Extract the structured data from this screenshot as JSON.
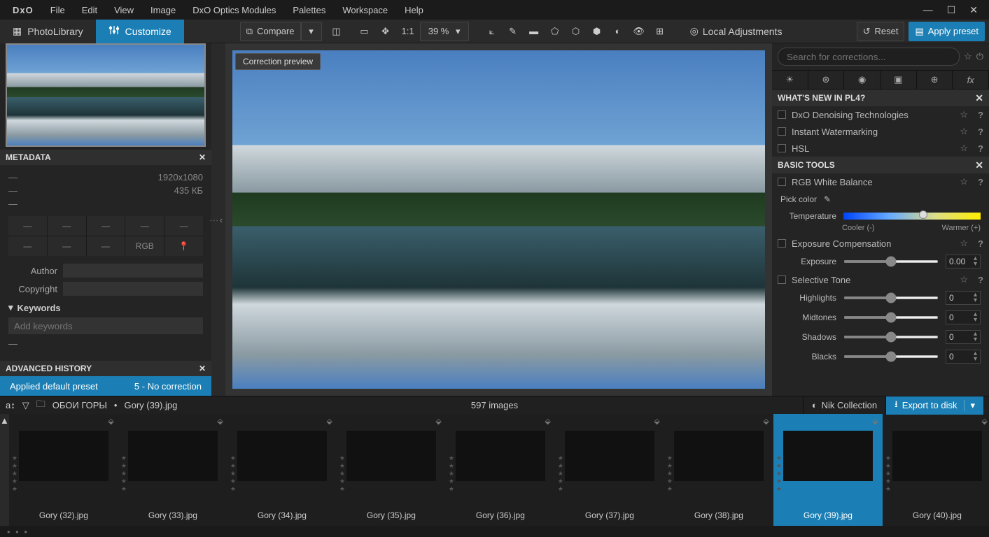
{
  "logo": "DxO",
  "menu": [
    "File",
    "Edit",
    "View",
    "Image",
    "DxO Optics Modules",
    "Palettes",
    "Workspace",
    "Help"
  ],
  "tabs": {
    "photolib": "PhotoLibrary",
    "customize": "Customize"
  },
  "toolbar": {
    "compare": "Compare",
    "scale": "1:1",
    "zoom": "39 %",
    "local": "Local Adjustments",
    "reset": "Reset",
    "apply": "Apply preset"
  },
  "chips": {
    "preview": "Correction preview"
  },
  "left": {
    "metadata_title": "METADATA",
    "dim": "1920x1080",
    "size": "435 КБ",
    "dash": "—",
    "rgb": "RGB",
    "author": "Author",
    "copyright": "Copyright",
    "keywords": "Keywords",
    "keywords_ph": "Add keywords",
    "history_title": "ADVANCED HISTORY",
    "hist_left": "Applied default preset",
    "hist_right": "5 - No correction"
  },
  "right": {
    "search_ph": "Search for corrections...",
    "whatsnew": "WHAT'S NEW IN PL4?",
    "wn": [
      "DxO Denoising Technologies",
      "Instant Watermarking",
      "HSL"
    ],
    "basic": "BASIC TOOLS",
    "rgbwb": "RGB White Balance",
    "pick": "Pick color",
    "temp": "Temperature",
    "cooler": "Cooler (-)",
    "warmer": "Warmer (+)",
    "expcomp": "Exposure Compensation",
    "exposure": "Exposure",
    "expval": "0.00",
    "seltone": "Selective Tone",
    "tones": [
      {
        "label": "Highlights",
        "val": "0"
      },
      {
        "label": "Midtones",
        "val": "0"
      },
      {
        "label": "Shadows",
        "val": "0"
      },
      {
        "label": "Blacks",
        "val": "0"
      }
    ]
  },
  "path": {
    "folder": "ОБОИ ГОРЫ",
    "file": "Gory (39).jpg",
    "count": "597 images",
    "nik": "Nik Collection",
    "export": "Export to disk"
  },
  "film": [
    {
      "name": "Gory (32).jpg",
      "cls": "mtn2"
    },
    {
      "name": "Gory (33).jpg",
      "cls": "mtn3"
    },
    {
      "name": "Gory (34).jpg",
      "cls": "mtn3"
    },
    {
      "name": "Gory (35).jpg",
      "cls": "mtn4"
    },
    {
      "name": "Gory (36).jpg",
      "cls": "mtn5"
    },
    {
      "name": "Gory (37).jpg",
      "cls": "mtn6"
    },
    {
      "name": "Gory (38).jpg",
      "cls": "mtn7"
    },
    {
      "name": "Gory (39).jpg",
      "cls": "mtn",
      "sel": true
    },
    {
      "name": "Gory (40).jpg",
      "cls": "mtn8"
    }
  ]
}
